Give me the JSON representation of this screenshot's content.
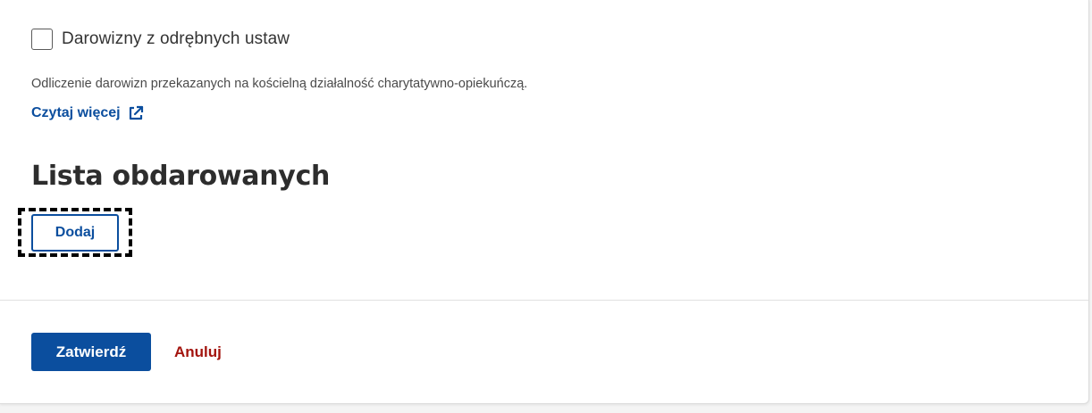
{
  "donation_option": {
    "checkbox_label": "Darowizny z odrębnych ustaw",
    "checked": false,
    "description": "Odliczenie darowizn przekazanych na kościelną działalność charytatywno-opiekuńczą.",
    "read_more_label": "Czytaj więcej",
    "read_more_icon": "external-link-icon"
  },
  "recipients": {
    "heading": "Lista obdarowanych",
    "add_label": "Dodaj"
  },
  "footer": {
    "confirm_label": "Zatwierdź",
    "cancel_label": "Anuluj"
  },
  "colors": {
    "primary": "#0b4e9e",
    "danger": "#a3140e",
    "text": "#333333",
    "focus": "#000000"
  }
}
